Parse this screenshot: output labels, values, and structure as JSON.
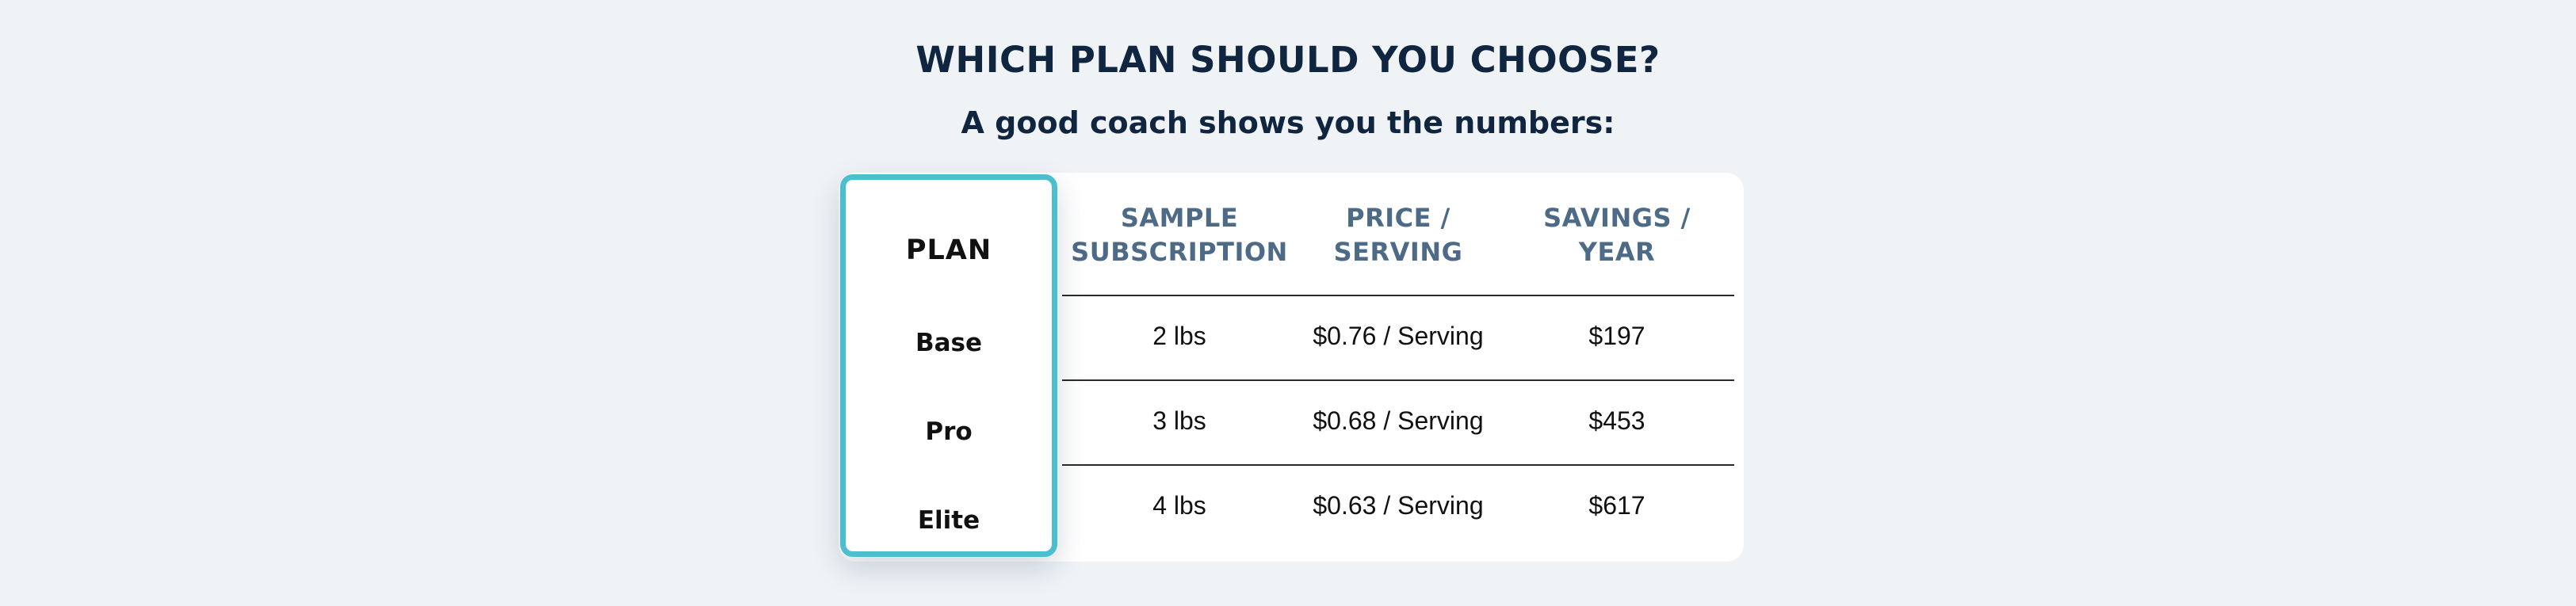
{
  "heading": {
    "title": "WHICH PLAN SHOULD YOU CHOOSE?",
    "subtitle": "A good coach shows you the numbers:"
  },
  "table": {
    "plan_header": "PLAN",
    "columns": [
      {
        "line1": "SAMPLE",
        "line2": "SUBSCRIPTION"
      },
      {
        "line1": "PRICE /",
        "line2": "SERVING"
      },
      {
        "line1": "SAVINGS /",
        "line2": "YEAR"
      }
    ],
    "rows": [
      {
        "plan": "Base",
        "subscription": "2 lbs",
        "price": "$0.76 / Serving",
        "savings": "$197"
      },
      {
        "plan": "Pro",
        "subscription": "3 lbs",
        "price": "$0.68 / Serving",
        "savings": "$453"
      },
      {
        "plan": "Elite",
        "subscription": "4 lbs",
        "price": "$0.63 / Serving",
        "savings": "$617"
      }
    ]
  },
  "colors": {
    "background": "#eff3f6",
    "accent_border": "#4bbfcf",
    "heading": "#0f2540",
    "column_header": "#4d6b87"
  }
}
